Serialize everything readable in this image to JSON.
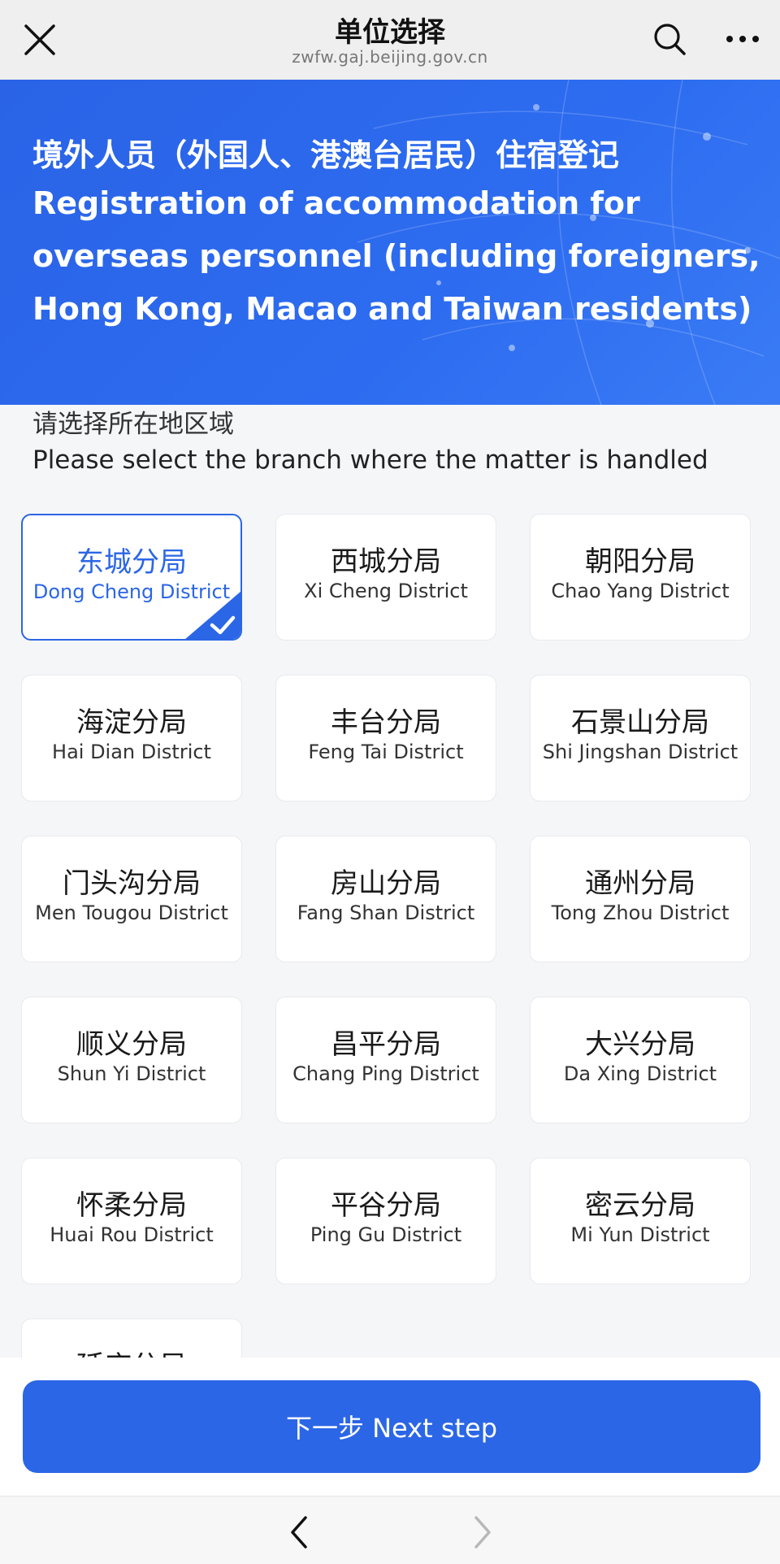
{
  "topbar": {
    "title": "单位选择",
    "url": "zwfw.gaj.beijing.gov.cn"
  },
  "banner": {
    "title_zh": "境外人员（外国人、港澳台居民）住宿登记",
    "title_en": "Registration of accommodation for overseas personnel (including foreigners, Hong Kong, Macao and Taiwan residents)"
  },
  "prompt": {
    "zh": "请选择所在地区域",
    "en": "Please select the branch where the matter is handled"
  },
  "districts": [
    {
      "zh": "东城分局",
      "en": "Dong Cheng District",
      "selected": true
    },
    {
      "zh": "西城分局",
      "en": "Xi Cheng District"
    },
    {
      "zh": "朝阳分局",
      "en": "Chao Yang District"
    },
    {
      "zh": "海淀分局",
      "en": "Hai Dian District"
    },
    {
      "zh": "丰台分局",
      "en": "Feng Tai District"
    },
    {
      "zh": "石景山分局",
      "en": "Shi Jingshan District"
    },
    {
      "zh": "门头沟分局",
      "en": "Men Tougou District"
    },
    {
      "zh": "房山分局",
      "en": "Fang Shan District"
    },
    {
      "zh": "通州分局",
      "en": "Tong Zhou District"
    },
    {
      "zh": "顺义分局",
      "en": "Shun Yi District"
    },
    {
      "zh": "昌平分局",
      "en": "Chang Ping District"
    },
    {
      "zh": "大兴分局",
      "en": "Da Xing District"
    },
    {
      "zh": "怀柔分局",
      "en": "Huai Rou District"
    },
    {
      "zh": "平谷分局",
      "en": "Ping Gu District"
    },
    {
      "zh": "密云分局",
      "en": "Mi Yun District"
    },
    {
      "zh": "延庆分局",
      "en": ""
    }
  ],
  "next_button": {
    "label": "下一步 Next step"
  },
  "colors": {
    "accent": "#2b66e6",
    "banner": "#2d6cf0"
  },
  "icons": {
    "close": "close-icon",
    "search": "search-icon",
    "more": "more-icon",
    "check": "check-icon",
    "back": "chevron-left-icon",
    "forward": "chevron-right-icon"
  }
}
